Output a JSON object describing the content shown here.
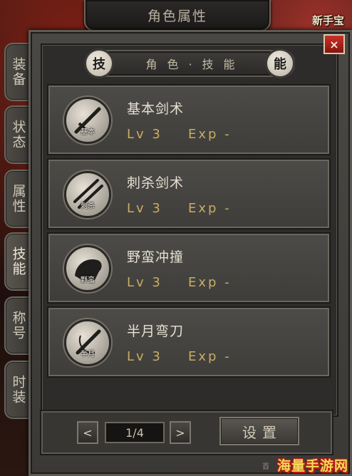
{
  "backdrop": {
    "corner_text": "新手宝"
  },
  "window": {
    "title": "角色属性",
    "close_label": "×"
  },
  "header": {
    "left_cap": "技",
    "right_cap": "能",
    "center": "角色·技能"
  },
  "side_tabs": [
    {
      "label": "装备",
      "active": false
    },
    {
      "label": "状态",
      "active": false
    },
    {
      "label": "属性",
      "active": false
    },
    {
      "label": "技能",
      "active": true
    },
    {
      "label": "称号",
      "active": false
    },
    {
      "label": "时装",
      "active": false
    }
  ],
  "skills": [
    {
      "name": "基本剑术",
      "level": "Lv 3",
      "exp": "Exp -",
      "icon_label": "基本",
      "icon": "sword-icon"
    },
    {
      "name": "刺杀剑术",
      "level": "Lv 3",
      "exp": "Exp -",
      "icon_label": "刺杀",
      "icon": "double-sword-icon"
    },
    {
      "name": "野蛮冲撞",
      "level": "Lv 3",
      "exp": "Exp -",
      "icon_label": "野蛮",
      "icon": "charge-icon"
    },
    {
      "name": "半月弯刀",
      "level": "Lv 3",
      "exp": "Exp -",
      "icon_label": "半月",
      "icon": "crescent-blade-icon"
    }
  ],
  "pagination": {
    "prev": "<",
    "next": ">",
    "page": "1/4"
  },
  "footer": {
    "settings_label": "设置",
    "note": "百"
  },
  "watermark": "海量手游网",
  "colors": {
    "panel": "#3f3d3a",
    "gold_text": "#c8ac62",
    "close_red": "#c9312a"
  }
}
